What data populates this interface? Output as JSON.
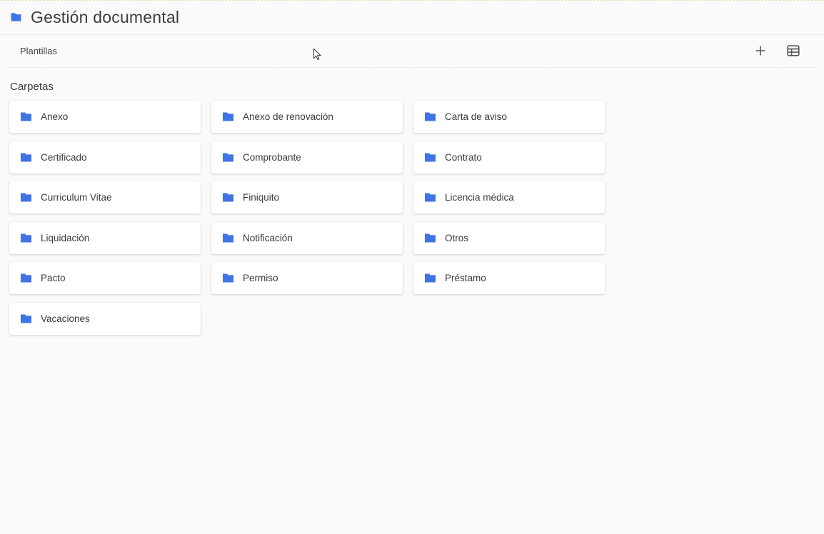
{
  "header": {
    "title": "Gestión documental",
    "icon": "folder-icon",
    "accent_color": "#3f73e6"
  },
  "toolbar": {
    "tab_label": "Plantillas",
    "add_icon": "plus-icon",
    "view_icon": "table-view-icon"
  },
  "section": {
    "label": "Carpetas"
  },
  "folders": [
    {
      "label": "Anexo"
    },
    {
      "label": "Anexo de renovación"
    },
    {
      "label": "Carta de aviso"
    },
    {
      "label": "Certificado"
    },
    {
      "label": "Comprobante"
    },
    {
      "label": "Contrato"
    },
    {
      "label": "Curriculum Vitae"
    },
    {
      "label": "Finiquito"
    },
    {
      "label": "Licencia médica"
    },
    {
      "label": "Liquidación"
    },
    {
      "label": "Notificación"
    },
    {
      "label": "Otros"
    },
    {
      "label": "Pacto"
    },
    {
      "label": "Permiso"
    },
    {
      "label": "Préstamo"
    },
    {
      "label": "Vacaciones"
    }
  ]
}
